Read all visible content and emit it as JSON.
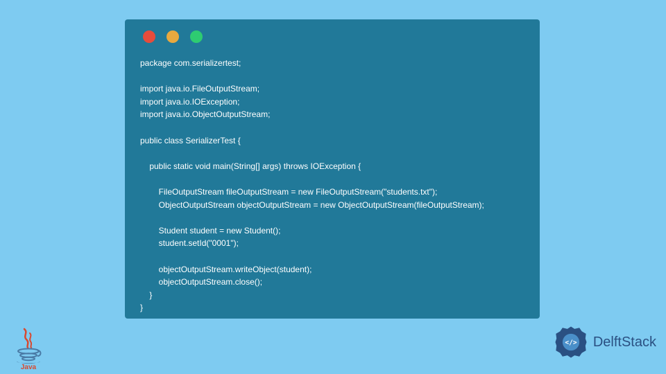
{
  "code": {
    "lines": [
      "package com.serializertest;",
      "",
      "import java.io.FileOutputStream;",
      "import java.io.IOException;",
      "import java.io.ObjectOutputStream;",
      "",
      "public class SerializerTest {",
      "",
      "    public static void main(String[] args) throws IOException {",
      "",
      "        FileOutputStream fileOutputStream = new FileOutputStream(\"students.txt\");",
      "        ObjectOutputStream objectOutputStream = new ObjectOutputStream(fileOutputStream);",
      "",
      "        Student student = new Student();",
      "        student.setId(\"0001\");",
      "",
      "        objectOutputStream.writeObject(student);",
      "        objectOutputStream.close();",
      "    }",
      "}"
    ]
  },
  "branding": {
    "java_label": "Java",
    "delft_label": "DelftStack"
  },
  "colors": {
    "background": "#7ecbf1",
    "window": "#217999",
    "text": "#ffffff",
    "red": "#e74c3c",
    "yellow": "#e8a93f",
    "green": "#2ecc71",
    "java_red": "#d84930",
    "delft_blue": "#2a5082"
  }
}
